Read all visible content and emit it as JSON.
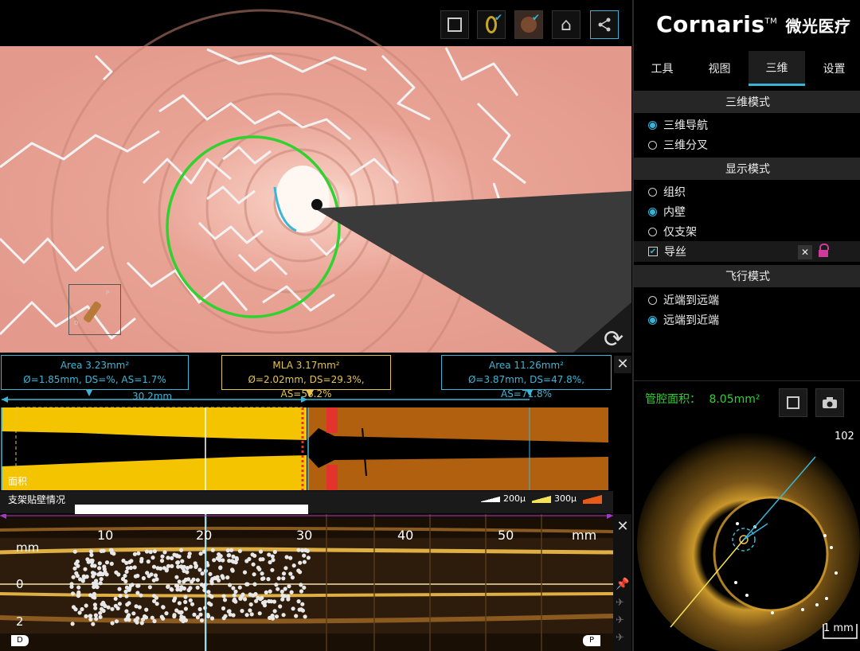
{
  "toolbar": {
    "buttons": [
      {
        "icon": "fullscreen-icon"
      },
      {
        "icon": "ring-check-icon"
      },
      {
        "icon": "texture-check-icon"
      },
      {
        "icon": "home-icon"
      },
      {
        "icon": "share-icon"
      }
    ]
  },
  "brand": {
    "logo_text": "Cornaris",
    "tm": "TM",
    "cn_text": "微光医疗"
  },
  "tabs": [
    "工具",
    "视图",
    "三维",
    "设置"
  ],
  "active_tab": "三维",
  "sections": {
    "mode_3d": {
      "title": "三维模式",
      "options": [
        "三维导航",
        "三维分叉"
      ],
      "selected": "三维导航"
    },
    "display": {
      "title": "显示模式",
      "options": [
        "组织",
        "内壁",
        "仅支架"
      ],
      "selected": "内壁",
      "guidewire_label": "导丝",
      "guidewire_checked": true
    },
    "flight": {
      "title": "飞行模式",
      "options": [
        "近端到远端",
        "远端到近端"
      ],
      "selected": "远端到近端"
    }
  },
  "lumen": {
    "label": "管腔面积：",
    "value": "8.05mm²"
  },
  "frame_number": "102",
  "scale_label": "1 mm",
  "measurements": {
    "left": {
      "line1": "Area 3.23mm²",
      "line2": "Ø=1.85mm, DS=%, AS=1.7%"
    },
    "mla": {
      "line1": "MLA 3.17mm²",
      "line2": "Ø=2.02mm, DS=29.3%, AS=56.2%"
    },
    "right": {
      "line1": "Area 11.26mm²",
      "line2": "Ø=3.87mm, DS=47.8%, AS=71.8%"
    },
    "length": "30.2mm"
  },
  "area_plot_label": "面积",
  "apposition": {
    "label": "支架贴壁情况",
    "legend": [
      "200μ",
      "300μ"
    ]
  },
  "longview": {
    "unit": "mm",
    "ticks": [
      "10",
      "20",
      "30",
      "40",
      "50"
    ],
    "y_labels": [
      "mm",
      "0",
      "2"
    ],
    "end_labels": [
      "D",
      "P"
    ]
  },
  "orientation_marker": {
    "d": "D",
    "p": "P"
  },
  "colors": {
    "accent": "#39b3d6",
    "yellow": "#e6c34a",
    "green": "#2fd22f",
    "tissue": "#e8a394",
    "plot_yellow": "#f5c400",
    "plot_brown": "#b0600e"
  }
}
